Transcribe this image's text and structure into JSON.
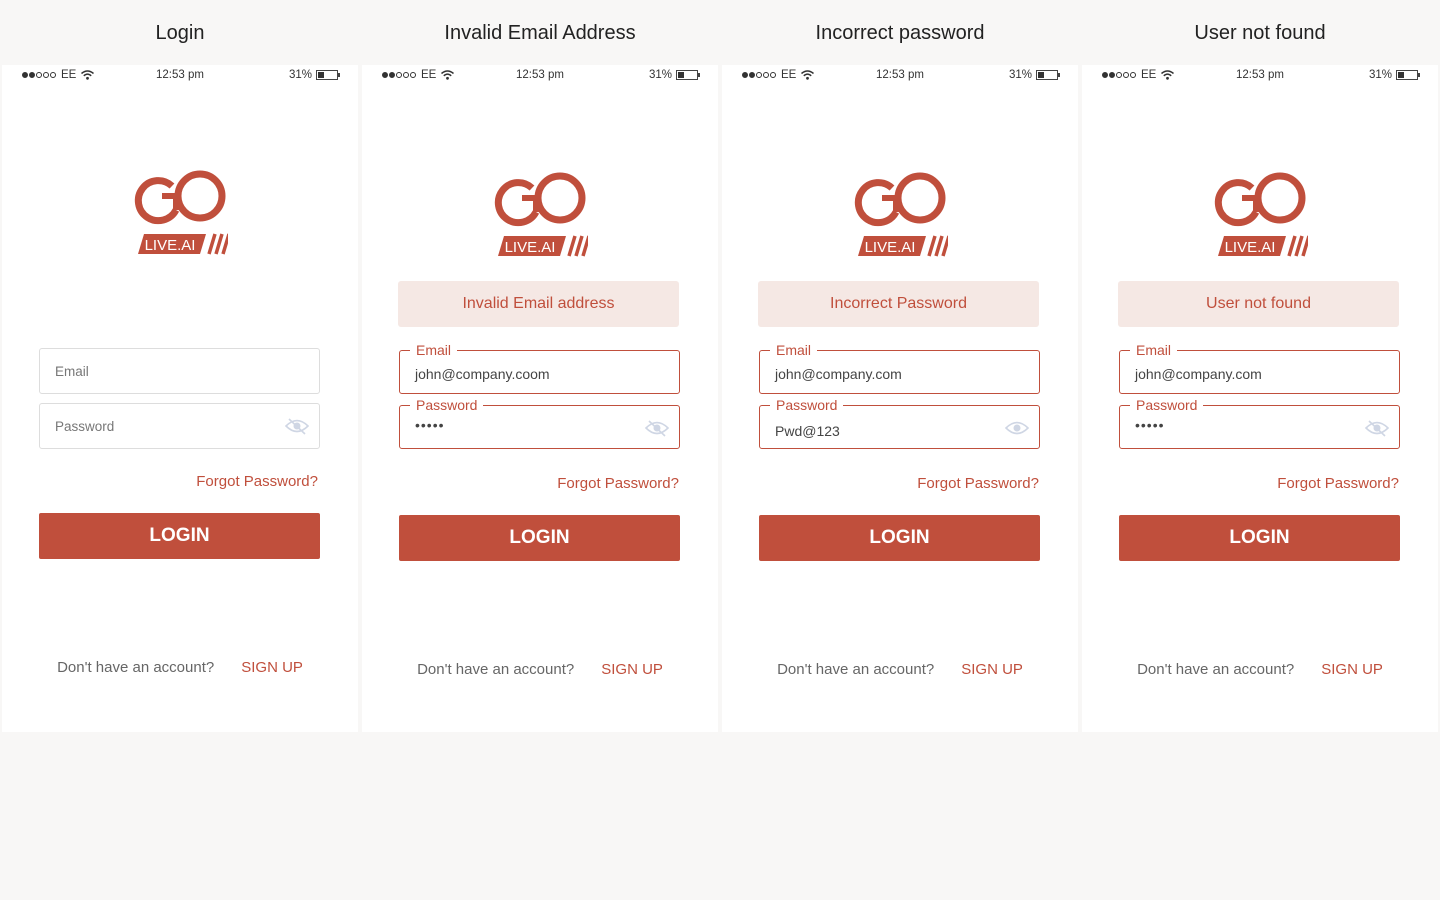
{
  "accent_color": "#c04f3c",
  "banner_bg": "#f5e8e4",
  "status_bar": {
    "carrier": "EE",
    "time": "12:53 pm",
    "battery": "31%",
    "signal_bars": 2,
    "battery_level": 0.31
  },
  "logo_text": "LIVE.AI",
  "screens": [
    {
      "title": "Login",
      "error": null,
      "email": {
        "label": "Email",
        "value": ""
      },
      "password": {
        "label": "Password",
        "value": "",
        "masked": true
      },
      "forgot": "Forgot Password?",
      "login": "LOGIN",
      "footer_question": "Don't have an account?",
      "signup": "SIGN UP"
    },
    {
      "title": "Invalid Email Address",
      "error": "Invalid Email address",
      "email": {
        "label": "Email",
        "value": "john@company.coom"
      },
      "password": {
        "label": "Password",
        "value": "•••••",
        "masked": true
      },
      "forgot": "Forgot Password?",
      "login": "LOGIN",
      "footer_question": "Don't have an account?",
      "signup": "SIGN UP"
    },
    {
      "title": "Incorrect password",
      "error": "Incorrect Password",
      "email": {
        "label": "Email",
        "value": "john@company.com"
      },
      "password": {
        "label": "Password",
        "value": "Pwd@123",
        "masked": false
      },
      "forgot": "Forgot Password?",
      "login": "LOGIN",
      "footer_question": "Don't have an account?",
      "signup": "SIGN UP"
    },
    {
      "title": "User not found",
      "error": "User not found",
      "email": {
        "label": "Email",
        "value": "john@company.com"
      },
      "password": {
        "label": "Password",
        "value": "•••••",
        "masked": true
      },
      "forgot": "Forgot Password?",
      "login": "LOGIN",
      "footer_question": "Don't have an account?",
      "signup": "SIGN UP"
    }
  ]
}
